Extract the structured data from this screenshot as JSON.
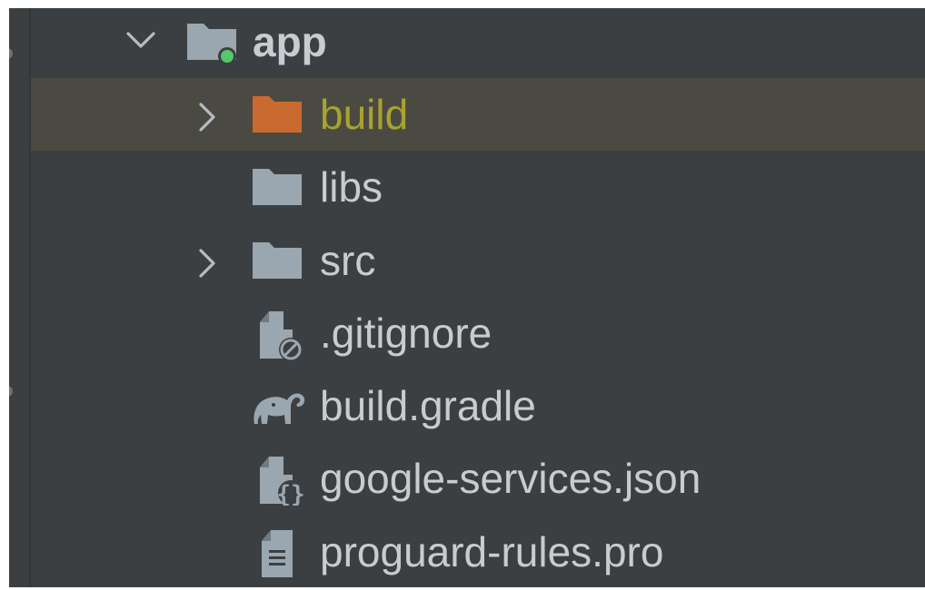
{
  "project_tree": {
    "root": {
      "label": "app",
      "icon": "module-folder-icon",
      "expanded": true
    },
    "items": [
      {
        "label": "build",
        "icon": "excluded-folder-icon",
        "expandable": true,
        "selected": true
      },
      {
        "label": "libs",
        "icon": "folder-icon",
        "expandable": false,
        "selected": false
      },
      {
        "label": "src",
        "icon": "folder-icon",
        "expandable": true,
        "selected": false
      },
      {
        "label": ".gitignore",
        "icon": "ignore-file-icon",
        "expandable": false,
        "selected": false
      },
      {
        "label": "build.gradle",
        "icon": "gradle-elephant-icon",
        "expandable": false,
        "selected": false
      },
      {
        "label": "google-services.json",
        "icon": "json-file-icon",
        "expandable": false,
        "selected": false
      },
      {
        "label": "proguard-rules.pro",
        "icon": "text-file-icon",
        "expandable": false,
        "selected": false
      }
    ]
  },
  "colors": {
    "background": "#3c3f41",
    "selected_row": "#4b4a42",
    "text": "#c7ccd1",
    "excluded_text": "#a8a32e",
    "excluded_folder": "#c96a2e",
    "folder": "#9aa7b0",
    "module_dot": "#55c86b"
  }
}
